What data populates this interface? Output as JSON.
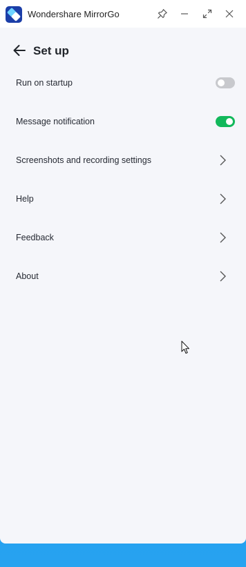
{
  "window": {
    "app_name": "Wondershare MirrorGo",
    "icons": [
      "app-logo",
      "pin-icon",
      "minimize-icon",
      "maximize-icon",
      "close-icon"
    ]
  },
  "header": {
    "title": "Set up",
    "back_icon": "arrow-left-icon"
  },
  "settings": {
    "run_on_startup": {
      "label": "Run on startup",
      "enabled": false
    },
    "message_notification": {
      "label": "Message notification",
      "enabled": true
    },
    "screenshots": {
      "label": "Screenshots and recording settings"
    },
    "help": {
      "label": "Help"
    },
    "feedback": {
      "label": "Feedback"
    },
    "about": {
      "label": "About"
    }
  },
  "colors": {
    "toggle_on": "#12b85b",
    "toggle_off": "#c8c9cd",
    "background": "#f5f6fa",
    "desktop": "#1f8ae8"
  }
}
